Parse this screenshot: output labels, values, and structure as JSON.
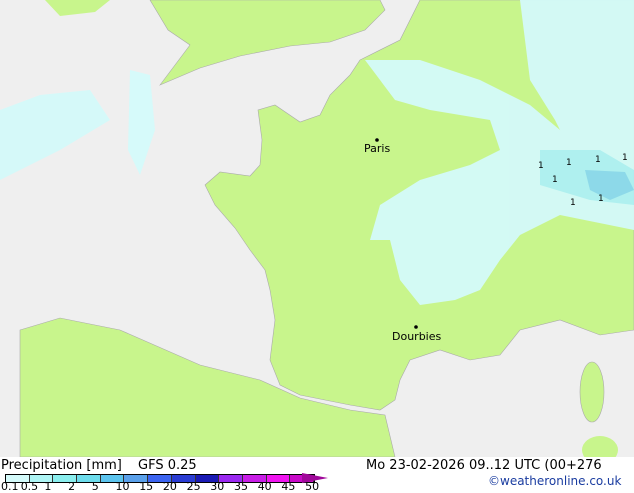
{
  "map": {
    "colors": {
      "sea": "#efefef",
      "land": "#c8f58c",
      "precip_light": "#d4fafa",
      "precip_mid": "#aef0f5",
      "precip_blue": "#8ad8ee"
    },
    "cities": [
      {
        "name": "Paris"
      },
      {
        "name": "Dourbies"
      }
    ],
    "symbols": [
      "1",
      "1",
      "1",
      "1",
      "1",
      "1",
      "1"
    ]
  },
  "legend": {
    "title": "Precipitation [mm]",
    "model": "GFS 0.25",
    "datetime": "Mo 23-02-2026 09..12 UTC (00+276",
    "credit": "©weatheronline.co.uk",
    "ticks": [
      "0.1",
      "0.5",
      "1",
      "2",
      "5",
      "10",
      "15",
      "20",
      "25",
      "30",
      "35",
      "40",
      "45",
      "50"
    ],
    "colors": [
      "#d4fafa",
      "#aef5f5",
      "#8aeeee",
      "#6ddcec",
      "#5cc4ee",
      "#5aa0ea",
      "#3c64f0",
      "#2a3cd2",
      "#1a1ab4",
      "#9a28f0",
      "#c81ee6",
      "#f014f0",
      "#c80ac8"
    ]
  }
}
